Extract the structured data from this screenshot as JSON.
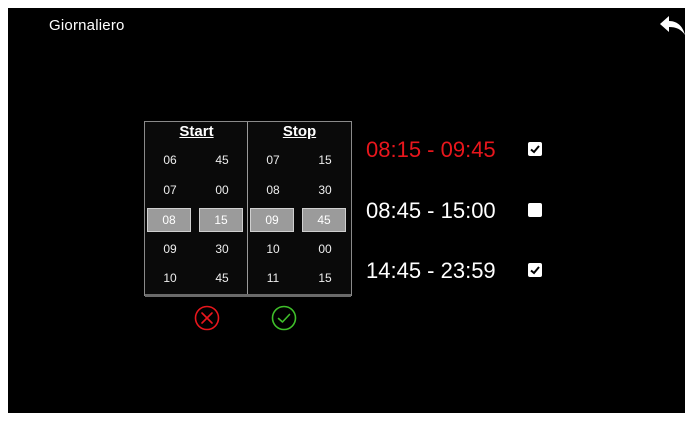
{
  "header": {
    "title": "Giornaliero",
    "back_icon": "back-arrow-icon"
  },
  "picker": {
    "start_label": "Start",
    "stop_label": "Stop",
    "start_hours": [
      "06",
      "07",
      "08",
      "09",
      "10"
    ],
    "start_minutes": [
      "45",
      "00",
      "15",
      "30",
      "45"
    ],
    "stop_hours": [
      "07",
      "08",
      "09",
      "10",
      "11"
    ],
    "stop_minutes": [
      "15",
      "30",
      "45",
      "00",
      "15"
    ],
    "selected_index": 2,
    "cancel_icon": "cancel-circle-icon",
    "confirm_icon": "confirm-check-icon",
    "cancel_color": "#e8161c",
    "confirm_color": "#3fbf2a"
  },
  "slots": [
    {
      "label": "08:15 - 09:45",
      "checked": true,
      "active": true
    },
    {
      "label": "08:45 - 15:00",
      "checked": false,
      "active": false
    },
    {
      "label": "14:45 - 23:59",
      "checked": true,
      "active": false
    }
  ],
  "colors": {
    "active_slot": "#e8161c",
    "background": "#000000"
  }
}
